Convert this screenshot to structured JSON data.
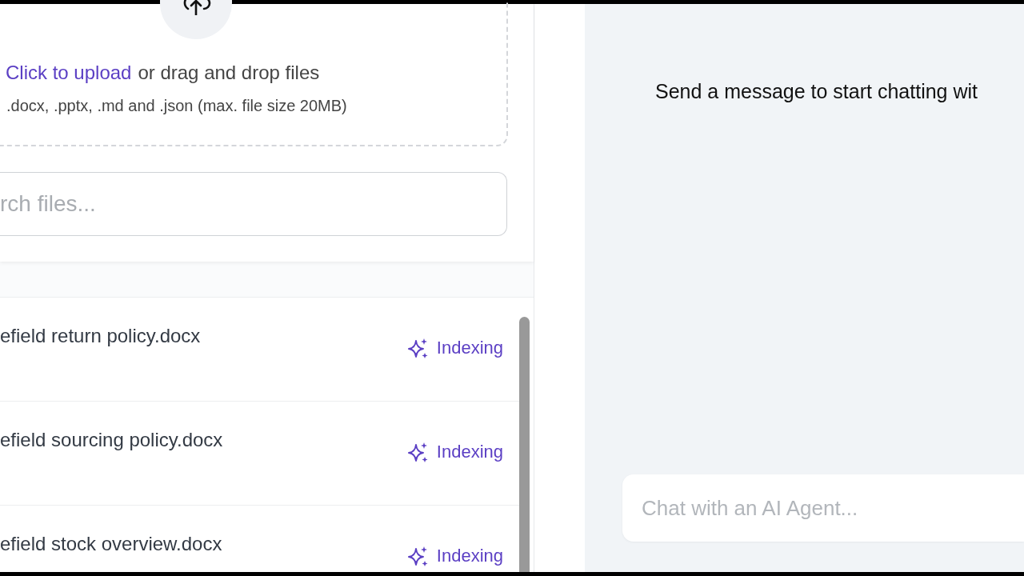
{
  "upload": {
    "link": "Click to upload",
    "text": "or drag and drop files",
    "formats": ".docx, .pptx, .md and .json (max. file size 20MB)"
  },
  "search": {
    "placeholder": "rch files..."
  },
  "files": [
    {
      "name": "efield return policy.docx",
      "status": {
        "kind": "indexing",
        "label": "Indexing"
      }
    },
    {
      "name": "efield sourcing policy.docx",
      "status": {
        "kind": "indexing",
        "label": "Indexing"
      }
    },
    {
      "name": "efield stock overview.docx",
      "status": {
        "kind": "indexing",
        "label": "Indexing"
      }
    }
  ],
  "chat": {
    "empty_message": "Send a message to start chatting wit",
    "input": {
      "placeholder": "Chat with an AI Agent..."
    }
  }
}
